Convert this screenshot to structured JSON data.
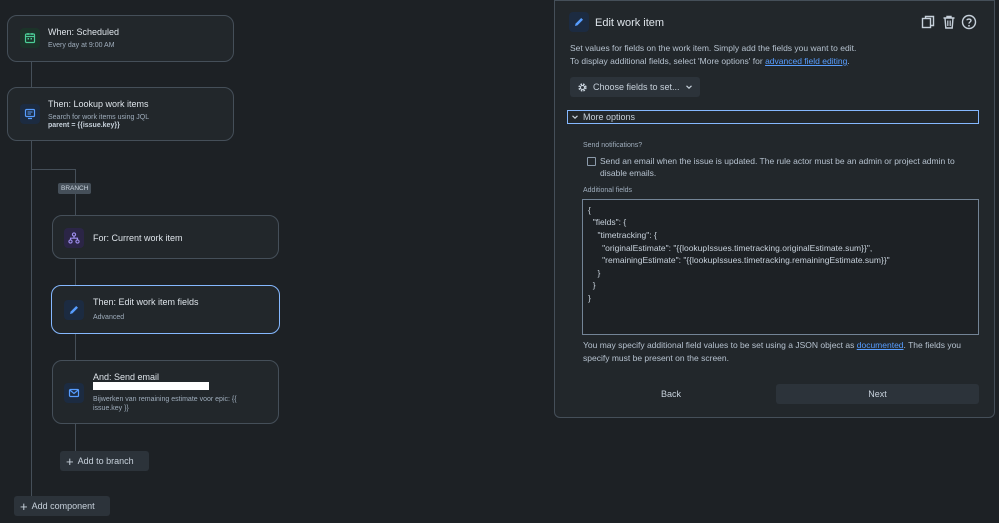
{
  "flow": {
    "trigger": {
      "title": "When: Scheduled",
      "subtitle": "Every day at 9:00 AM"
    },
    "lookup": {
      "title": "Then: Lookup work items",
      "subtitle": "Search for work items using JQL",
      "query": "parent = {{issue.key}}"
    },
    "branch_label": "BRANCH",
    "for_each": {
      "title": "For: Current work item"
    },
    "edit": {
      "title": "Then: Edit work item fields",
      "subtitle": "Advanced"
    },
    "email": {
      "title": "And: Send email",
      "subtitle_line1": "Bijwerken van remaining estimate voor epic: {{",
      "subtitle_line2": "issue.key }}"
    },
    "add_to_branch": "Add to branch",
    "add_component": "Add component"
  },
  "panel": {
    "title": "Edit work item",
    "desc_line1": "Set values for fields on the work item. Simply add the fields you want to edit.",
    "desc_line2_prefix": "To display additional fields, select 'More options' for ",
    "desc_link": "advanced field editing",
    "desc_line2_suffix": ".",
    "choose_fields": "Choose fields to set...",
    "more_options": "More options",
    "send_notifications_label": "Send notifications?",
    "checkbox_line1": "Send an email when the issue is updated. The rule actor must be an admin or project admin to",
    "checkbox_line2": "disable emails.",
    "checkbox_checked": false,
    "additional_fields_label": "Additional fields",
    "json_lines": [
      "{",
      "  \"fields\": {",
      "    \"timetracking\": {",
      "      \"originalEstimate\": \"{{lookupIssues.timetracking.originalEstimate.sum}}\",",
      "      \"remainingEstimate\": \"{{lookupIssues.timetracking.remainingEstimate.sum}}\"",
      "    }",
      "  }",
      "}"
    ],
    "help_line1_prefix": "You may specify additional field values to be set using a JSON object as ",
    "help_link": "documented",
    "help_line1_suffix": ". The fields you",
    "help_line2": "specify must be present on the screen.",
    "back": "Back",
    "next": "Next"
  },
  "colors": {
    "background": "#1d2125",
    "accent": "#85b8ff",
    "link": "#579dff",
    "trigger_icon": "#4bce97",
    "lookup_icon": "#579dff",
    "branch_icon": "#9f8fef"
  },
  "icons": {
    "trigger": "calendar-icon",
    "lookup": "monitor-icon",
    "for_each": "hierarchy-icon",
    "edit": "pencil-icon",
    "email": "email-icon",
    "copy": "copy-icon",
    "delete": "trash-icon",
    "help": "help-icon",
    "settings": "gear-icon",
    "chevron": "chevron-down-icon"
  }
}
